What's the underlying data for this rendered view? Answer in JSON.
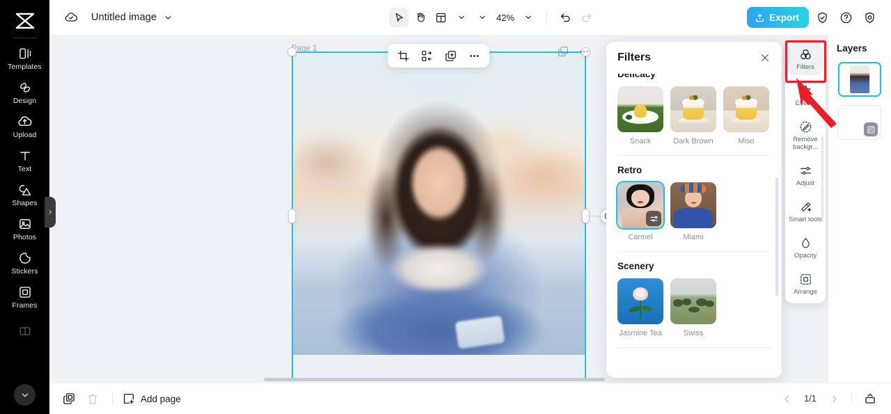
{
  "app": {
    "title": "Untitled image",
    "canvas_bg": "#eff1f4",
    "accent": "#17c4e8",
    "annotation_color": "#ee1c25"
  },
  "left_rail": {
    "logo_name": "capcut-logo",
    "items": [
      {
        "label": "Templates",
        "icon": "templates-icon"
      },
      {
        "label": "Design",
        "icon": "design-icon"
      },
      {
        "label": "Upload",
        "icon": "upload-icon"
      },
      {
        "label": "Text",
        "icon": "text-icon"
      },
      {
        "label": "Shapes",
        "icon": "shapes-icon"
      },
      {
        "label": "Photos",
        "icon": "photos-icon"
      },
      {
        "label": "Stickers",
        "icon": "stickers-icon"
      },
      {
        "label": "Frames",
        "icon": "frames-icon"
      }
    ],
    "collapse_icon": "chevron-down-icon"
  },
  "topbar": {
    "cloud_icon": "cloud-saved-icon",
    "title": "Untitled image",
    "title_caret": "chevron-down-icon",
    "tools": [
      {
        "name": "select-tool",
        "icon": "cursor-icon",
        "active": true
      },
      {
        "name": "hand-tool",
        "icon": "hand-icon",
        "active": false
      },
      {
        "name": "layout-tool",
        "icon": "layout-icon",
        "active": false
      }
    ],
    "layout_caret": "chevron-down-icon",
    "zoom_level": "42%",
    "zoom_caret": "chevron-down-icon",
    "undo_icon": "undo-icon",
    "redo_icon": "redo-icon",
    "export_label": "Export",
    "export_icon": "export-upload-icon",
    "right_icons": [
      {
        "name": "shield-icon"
      },
      {
        "name": "help-icon"
      },
      {
        "name": "settings-icon"
      }
    ]
  },
  "canvas": {
    "page_label": "Page 1",
    "float_toolbar": [
      {
        "name": "crop-button",
        "icon": "crop-icon"
      },
      {
        "name": "replace-button",
        "icon": "replace-icon"
      },
      {
        "name": "duplicate-button",
        "icon": "duplicate-icon"
      },
      {
        "name": "more-options-button",
        "icon": "more-horizontal-icon"
      }
    ],
    "corner_tools": [
      {
        "name": "duplicate-page-button",
        "icon": "duplicate-icon"
      },
      {
        "name": "page-more-button",
        "icon": "more-horizontal-icon"
      }
    ]
  },
  "filters_panel": {
    "title": "Filters",
    "close_icon": "close-icon",
    "sections": [
      {
        "name": "Delicacy",
        "clipped": true,
        "items": [
          {
            "label": "Snack",
            "selected": false,
            "art": "th-snack"
          },
          {
            "label": "Dark Brown",
            "selected": false,
            "art": "th-dark"
          },
          {
            "label": "Miso",
            "selected": false,
            "art": "th-miso"
          }
        ]
      },
      {
        "name": "Retro",
        "clipped": false,
        "items": [
          {
            "label": "Carmel",
            "selected": true,
            "art": "th-carmel"
          },
          {
            "label": "Miami",
            "selected": false,
            "art": "th-miami"
          }
        ]
      },
      {
        "name": "Scenery",
        "clipped": false,
        "items": [
          {
            "label": "Jasmine Tea",
            "selected": false,
            "art": "th-jasmine"
          },
          {
            "label": "Swiss",
            "selected": false,
            "art": "th-swiss"
          }
        ]
      }
    ]
  },
  "tool_rail": {
    "items": [
      {
        "label": "Filters",
        "icon": "filters-icon",
        "active": true
      },
      {
        "label": "Effects",
        "icon": "effects-icon",
        "active": false
      },
      {
        "label": "Remove backgr...",
        "icon": "remove-background-icon",
        "active": false
      },
      {
        "label": "Adjust",
        "icon": "adjust-icon",
        "active": false
      },
      {
        "label": "Smart tools",
        "icon": "smart-tools-icon",
        "active": false
      },
      {
        "label": "Opacity",
        "icon": "opacity-icon",
        "active": false
      },
      {
        "label": "Arrange",
        "icon": "arrange-icon",
        "active": false
      }
    ]
  },
  "layers_panel": {
    "title": "Layers",
    "items": [
      {
        "name": "layer-image",
        "selected": true,
        "type": "image"
      },
      {
        "name": "layer-background",
        "selected": false,
        "type": "background"
      }
    ]
  },
  "bottombar": {
    "duplicate_icon": "duplicate-page-icon",
    "delete_icon": "trash-icon",
    "add_page_label": "Add page",
    "add_page_icon": "add-page-icon",
    "prev_icon": "chevron-left-icon",
    "page_indicator": "1/1",
    "next_icon": "chevron-right-icon",
    "grid_view_icon": "page-view-icon"
  }
}
